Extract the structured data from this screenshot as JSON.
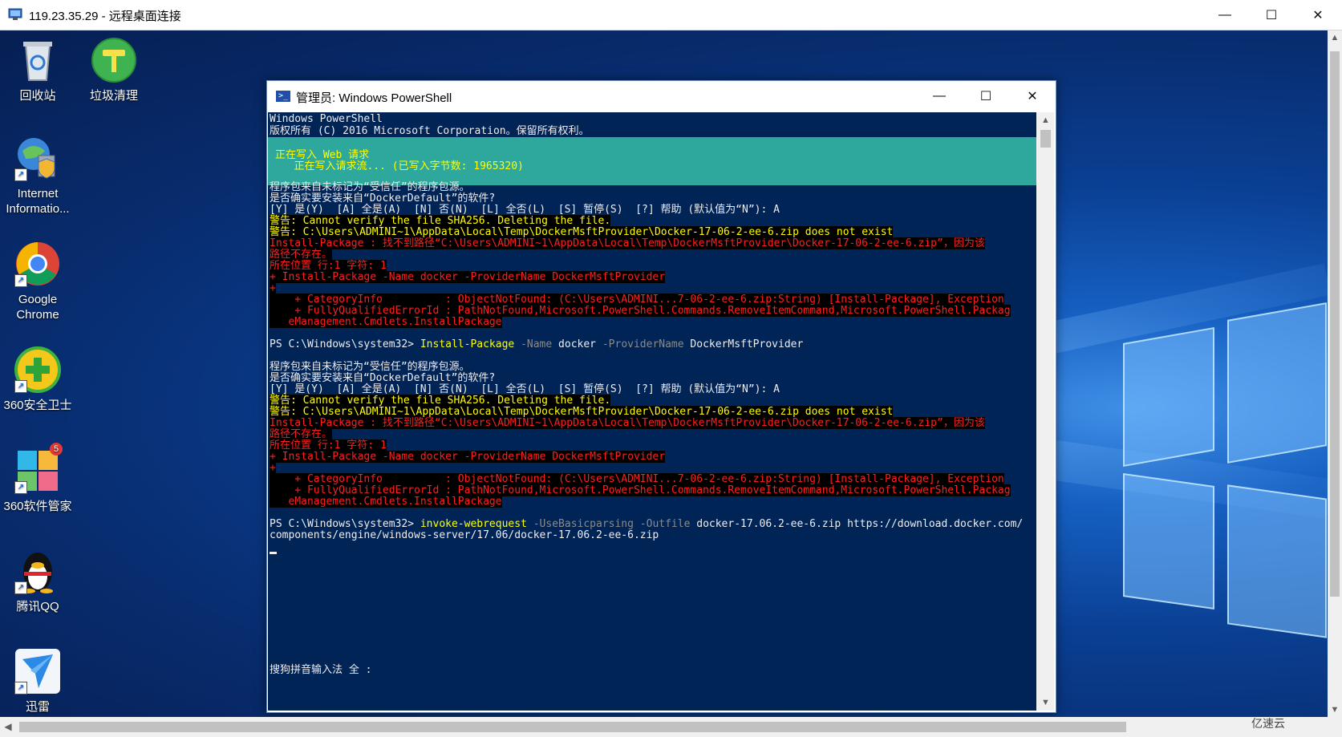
{
  "rdp": {
    "title": "119.23.35.29 - 远程桌面连接",
    "minimize": "—",
    "maximize": "☐",
    "close": "✕"
  },
  "desktop": {
    "icons": [
      {
        "label": "回收站",
        "icon": "recycle-bin-icon"
      },
      {
        "label": "垃圾清理",
        "icon": "broom-cleaner-icon"
      },
      {
        "label": "Internet Informatio...",
        "icon": "iis-manager-icon"
      },
      {
        "label": "Google Chrome",
        "icon": "chrome-icon"
      },
      {
        "label": "360安全卫士",
        "icon": "360-security-icon"
      },
      {
        "label": "360软件管家",
        "icon": "360-software-manager-icon",
        "badge": "5"
      },
      {
        "label": "腾讯QQ",
        "icon": "qq-penguin-icon"
      },
      {
        "label": "迅雷",
        "icon": "xunlei-bird-icon"
      }
    ],
    "watermark": "亿速云"
  },
  "powershell": {
    "title": "管理员: Windows PowerShell",
    "minimize": "—",
    "maximize": "☐",
    "close": "✕",
    "header": [
      "Windows PowerShell",
      "版权所有 (C) 2016 Microsoft Corporation。保留所有权利。"
    ],
    "progress": {
      "activity": "正在写入 Web 请求",
      "status": "   正在写入请求流... (已写入字节数: 1965320)"
    },
    "block1": {
      "trust1": "程序包来自未标记为“受信任”的程序包源。",
      "trust2": "是否确实要安装来自“DockerDefault”的软件?",
      "prompt": "[Y] 是(Y)  [A] 全是(A)  [N] 否(N)  [L] 全否(L)  [S] 暂停(S)  [?] 帮助 (默认值为“N”): A",
      "warn1": "警告: Cannot verify the file SHA256. Deleting the file.",
      "warn2": "警告: C:\\Users\\ADMINI~1\\AppData\\Local\\Temp\\DockerMsftProvider\\Docker-17-06-2-ee-6.zip does not exist",
      "err1": "Install-Package : 找不到路径“C:\\Users\\ADMINI~1\\AppData\\Local\\Temp\\DockerMsftProvider\\Docker-17-06-2-ee-6.zip”，因为该",
      "err2": "路径不存在。",
      "err3": "所在位置 行:1 字符: 1",
      "err4": "+ Install-Package -Name docker -ProviderName DockerMsftProvider",
      "err5": "+",
      "err6": "    + CategoryInfo          : ObjectNotFound: (C:\\Users\\ADMINI...7-06-2-ee-6.zip:String) [Install-Package], Exception",
      "err7": "    + FullyQualifiedErrorId : PathNotFound,Microsoft.PowerShell.Commands.RemoveItemCommand,Microsoft.PowerShell.Packag",
      "err8": "   eManagement.Cmdlets.InstallPackage"
    },
    "command1": {
      "prompt": "PS C:\\Windows\\system32> ",
      "cmdlet": "Install-Package",
      "p1": " -Name",
      "v1": " docker",
      "p2": " -ProviderName",
      "v2": " DockerMsftProvider"
    },
    "command2": {
      "prompt": "PS C:\\Windows\\system32> ",
      "cmdlet": "invoke-webrequest",
      "p1": " -UseBasicparsing",
      "p2": " -Outfile",
      "v1": " docker-17.06.2-ee-6.zip https://download.docker.com/",
      "cont": "components/engine/windows-server/17.06/docker-17.06.2-ee-6.zip"
    },
    "ime": "搜狗拼音输入法 全 :"
  },
  "colors": {
    "console_bg": "#012456",
    "progress_bg": "#2ea79d",
    "warning": "#ffff00",
    "error": "#ff1e1e"
  }
}
